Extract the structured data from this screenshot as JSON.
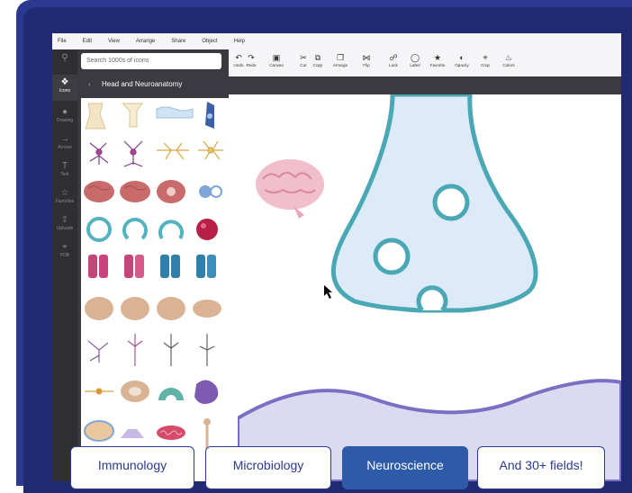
{
  "menu": [
    "File",
    "Edit",
    "View",
    "Arrange",
    "Share",
    "Object",
    "Help"
  ],
  "search": {
    "placeholder": "Search 1000s of icons"
  },
  "sidebar": {
    "items": [
      {
        "label": "Icons",
        "icon": "icons-icon"
      },
      {
        "label": "Drawing",
        "icon": "drawing-icon"
      },
      {
        "label": "Arrows",
        "icon": "arrows-icon"
      },
      {
        "label": "Text",
        "icon": "text-icon"
      },
      {
        "label": "Favorites",
        "icon": "star-icon"
      },
      {
        "label": "Uploads",
        "icon": "upload-icon"
      },
      {
        "label": "PDB",
        "icon": "pdb-icon"
      }
    ]
  },
  "panel": {
    "title": "Head and Neuroanatomy"
  },
  "toolbar": {
    "items": [
      "Undo",
      "Redo",
      "Canvas",
      "Cut",
      "Copy",
      "Arrange",
      "Flip",
      "Lock",
      "Label",
      "Favorite",
      "Opacity",
      "Crop",
      "Colors"
    ]
  },
  "fields": [
    "Immunology",
    "Microbiology",
    "Neuroscience",
    "And 30+ fields!"
  ],
  "colors": {
    "accent": "#2b3990",
    "active_tab": "#2d5ba8",
    "teal": "#5fb3bd",
    "purple": "#7b6fc4"
  }
}
